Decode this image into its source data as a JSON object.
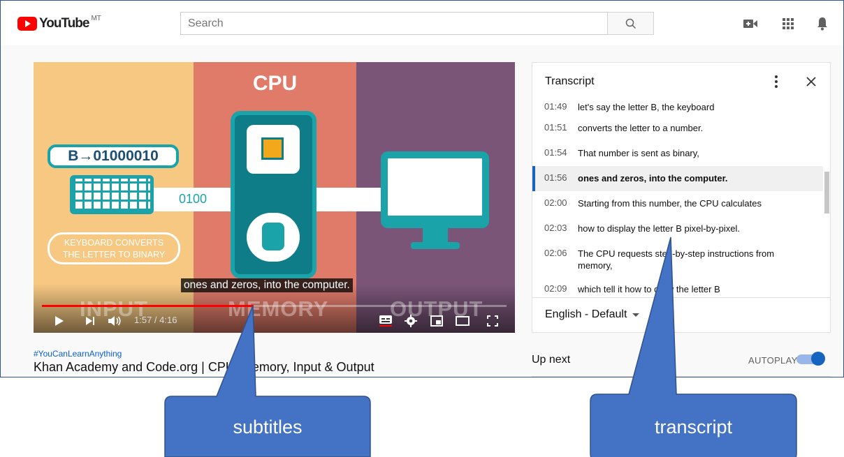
{
  "app": {
    "logo_text": "YouTube",
    "logo_superscript": "MT"
  },
  "search": {
    "placeholder": "Search"
  },
  "header_icons": [
    "create-video-icon",
    "apps-grid-icon",
    "notifications-bell-icon"
  ],
  "video": {
    "scene": {
      "cpu_label": "CPU",
      "binary_box": "B→01000010",
      "wire_binary": "0100",
      "keyboard_caption_line1": "KEYBOARD CONVERTS",
      "keyboard_caption_line2": "THE LETTER TO BINARY",
      "ghost_input": "INPUT",
      "ghost_memory": "MEMORY",
      "ghost_output": "OUTPUT"
    },
    "subtitle": "ones and zeros, into the computer.",
    "time_display": "1:57 / 4:16",
    "progress_fraction": 0.455,
    "hashtag": "#YouCanLearnAnything",
    "title": "Khan Academy and Code.org | CPU, Memory, Input & Output"
  },
  "transcript": {
    "title": "Transcript",
    "language": "English - Default",
    "rows": [
      {
        "time": "01:49",
        "text": "let's say the letter B, the keyboard",
        "active": false
      },
      {
        "time": "01:51",
        "text": "converts the letter to a number.",
        "active": false
      },
      {
        "time": "01:54",
        "text": "That number is sent as binary,",
        "active": false
      },
      {
        "time": "01:56",
        "text": "ones and zeros, into the computer.",
        "active": true
      },
      {
        "time": "02:00",
        "text": "Starting from this number, the CPU calculates",
        "active": false
      },
      {
        "time": "02:03",
        "text": "how to display the letter B pixel-by-pixel.",
        "active": false
      },
      {
        "time": "02:06",
        "text": "The CPU requests step-by-step instructions from memory,",
        "active": false
      },
      {
        "time": "02:09",
        "text": "which tell it how to draw the letter B",
        "active": false
      }
    ]
  },
  "sidebar": {
    "up_next": "Up next",
    "autoplay": "AUTOPLAY",
    "autoplay_on": true
  },
  "callouts": {
    "subtitles": "subtitles",
    "transcript": "transcript",
    "color": "#4472c4"
  }
}
